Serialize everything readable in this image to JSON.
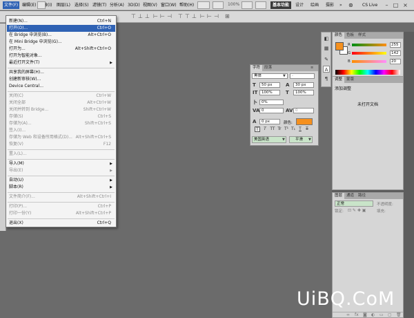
{
  "app": {
    "logo": "Ps"
  },
  "menubar": {
    "items": [
      "文件(F)",
      "编辑(E)",
      "图像(I)",
      "图层(L)",
      "选择(S)",
      "滤镜(T)",
      "分析(A)",
      "3D(D)",
      "视图(V)",
      "窗口(W)",
      "帮助(H)"
    ],
    "zoom": "100%",
    "workspaces": [
      "基本功能",
      "设计",
      "绘画",
      "摄影"
    ],
    "more": "»",
    "cs_live": "CS Live"
  },
  "file_menu": {
    "items": [
      {
        "label": "新建(N)...",
        "shortcut": "Ctrl+N"
      },
      {
        "label": "打开(O)...",
        "shortcut": "Ctrl+O"
      },
      {
        "label": "在 Bridge 中浏览(B)...",
        "shortcut": "Alt+Ctrl+O"
      },
      {
        "label": "在 Mini Bridge 中浏览(G)...",
        "shortcut": ""
      },
      {
        "label": "打开为...",
        "shortcut": "Alt+Shift+Ctrl+O"
      },
      {
        "label": "打开为智能对象...",
        "shortcut": ""
      },
      {
        "label": "最近打开文件(T)",
        "shortcut": ""
      },
      {
        "label": "共享我的屏幕(H)...",
        "shortcut": ""
      },
      {
        "label": "创建新审核(W)...",
        "shortcut": ""
      },
      {
        "label": "Device Central...",
        "shortcut": ""
      },
      {
        "label": "关闭(C)",
        "shortcut": "Ctrl+W"
      },
      {
        "label": "关闭全部",
        "shortcut": "Alt+Ctrl+W"
      },
      {
        "label": "关闭并转到 Bridge...",
        "shortcut": "Shift+Ctrl+W"
      },
      {
        "label": "存储(S)",
        "shortcut": "Ctrl+S"
      },
      {
        "label": "存储为(A)...",
        "shortcut": "Shift+Ctrl+S"
      },
      {
        "label": "签入(I)...",
        "shortcut": ""
      },
      {
        "label": "存储为 Web 和设备所用格式(D)...",
        "shortcut": "Alt+Shift+Ctrl+S"
      },
      {
        "label": "恢复(V)",
        "shortcut": "F12"
      },
      {
        "label": "置入(L)...",
        "shortcut": ""
      },
      {
        "label": "导入(M)",
        "shortcut": ""
      },
      {
        "label": "导出(E)",
        "shortcut": ""
      },
      {
        "label": "自动(U)",
        "shortcut": ""
      },
      {
        "label": "脚本(R)",
        "shortcut": ""
      },
      {
        "label": "文件简介(F)...",
        "shortcut": "Alt+Shift+Ctrl+I"
      },
      {
        "label": "打印(P)...",
        "shortcut": "Ctrl+P"
      },
      {
        "label": "打印一份(Y)",
        "shortcut": "Alt+Shift+Ctrl+P"
      },
      {
        "label": "退出(X)",
        "shortcut": "Ctrl+Q"
      }
    ]
  },
  "character_panel": {
    "tabs": [
      "字符",
      "段落"
    ],
    "font_family": "黑体",
    "font_style": "-",
    "font_size": "50 px",
    "leading": "30 px",
    "vertical_scale": "100%",
    "horizontal_scale": "100%",
    "kerning_percent": "0%",
    "tracking": "0",
    "kerning": "0",
    "baseline_shift": "0 px",
    "color_label": "颜色:",
    "color_hex": "#f5901e",
    "style_buttons": [
      "T",
      "T",
      "TT",
      "Tr",
      "T¹",
      "T₁",
      "T",
      "T"
    ],
    "language": "美国英语",
    "aa_label": "aa",
    "antialias": "平滑"
  },
  "color_panel": {
    "tabs": [
      "颜色",
      "色板",
      "样式"
    ],
    "fg_hex": "#f5901e",
    "channels": [
      {
        "label": "R",
        "value": "255"
      },
      {
        "label": "G",
        "value": "142"
      },
      {
        "label": "B",
        "value": "20"
      }
    ]
  },
  "adjust_panel": {
    "tabs": [
      "调整",
      "蒙版"
    ],
    "add_label": "添加调整",
    "no_doc": "未打开文档"
  },
  "layers_panel": {
    "tabs": [
      "图层",
      "通道",
      "路径"
    ],
    "blend_mode": "正常",
    "opacity_label": "不透明度:",
    "lock_label": "锁定:",
    "fill_label": "填充:"
  },
  "watermark": "UiBQ.CoM"
}
